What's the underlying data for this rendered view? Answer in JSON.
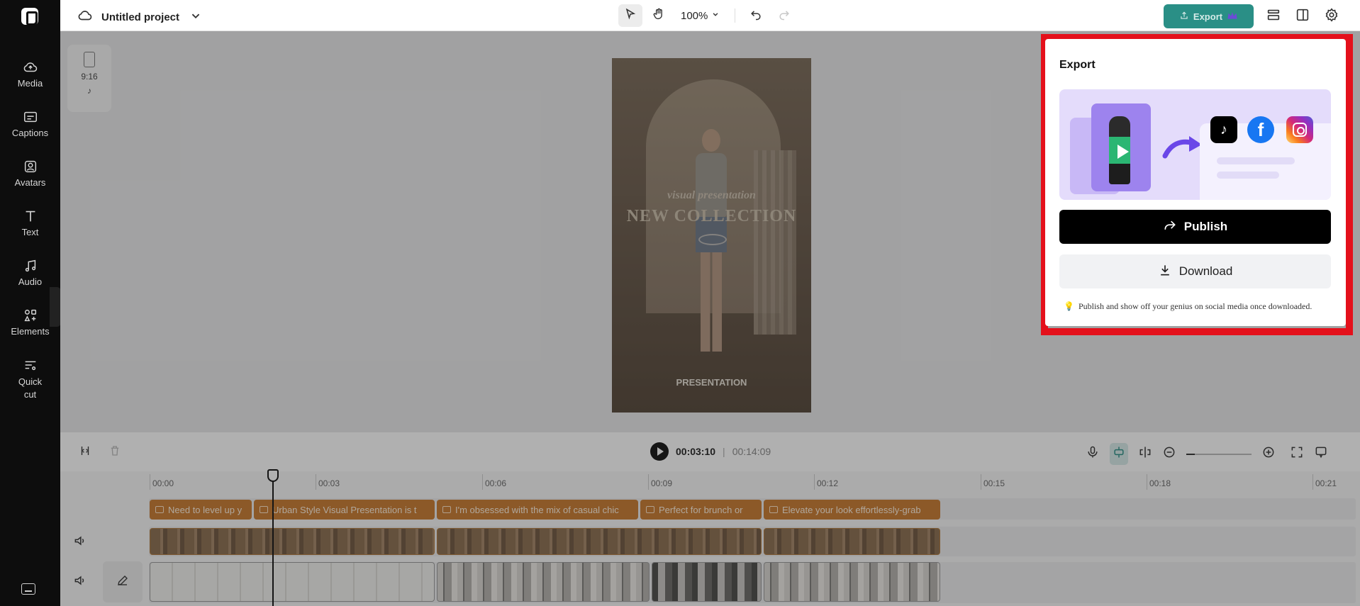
{
  "sidebar": {
    "items": [
      {
        "label": "Media",
        "icon": "cloud-upload-icon"
      },
      {
        "label": "Captions",
        "icon": "captions-icon"
      },
      {
        "label": "Avatars",
        "icon": "avatar-icon"
      },
      {
        "label": "Text",
        "icon": "text-icon"
      },
      {
        "label": "Audio",
        "icon": "music-note-icon"
      },
      {
        "label": "Elements",
        "icon": "elements-icon"
      },
      {
        "label": "Quick\ncut",
        "icon": "scissors-icon"
      }
    ]
  },
  "header": {
    "project_title": "Untitled project",
    "zoom": "100%",
    "export_label": "Export"
  },
  "canvas": {
    "ratio": "9:16",
    "video_text": {
      "line1": "visual presentation",
      "line2": "NEW COLLECTION",
      "caption": "PRESENTATION"
    }
  },
  "timeline": {
    "current_time": "00:03:10",
    "separator": "|",
    "total_time": "00:14:09",
    "ruler": [
      "00:00",
      "00:03",
      "00:06",
      "00:09",
      "00:12",
      "00:15",
      "00:18",
      "00:21"
    ],
    "captions": [
      "Need to level up y",
      "Urban Style Visual Presentation is t",
      "I'm obsessed with the mix of casual chic",
      "Perfect for brunch or",
      "Elevate your look effortlessly-grab"
    ]
  },
  "export_panel": {
    "title": "Export",
    "publish_label": "Publish",
    "download_label": "Download",
    "hint": "Publish and show off your genius on social media once downloaded."
  },
  "colors": {
    "accent": "#2a8f86",
    "highlight_frame": "#e4101b",
    "caption_clip": "#c87a2e"
  }
}
